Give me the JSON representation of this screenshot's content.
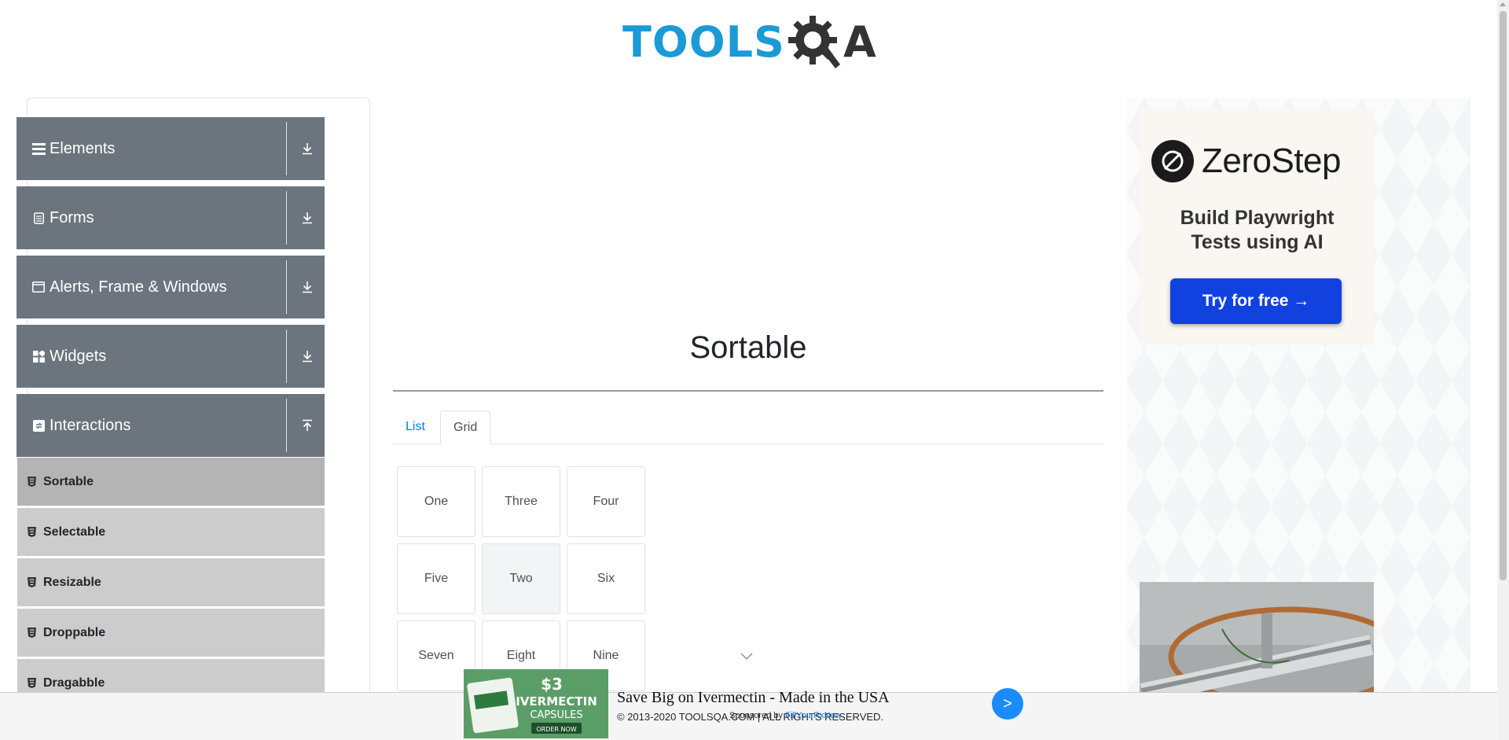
{
  "header": {
    "logo_text": "TOOLS",
    "logo_suffix": "A"
  },
  "sidebar": {
    "groups": [
      {
        "label": "Elements",
        "icon": "hamburger-icon",
        "state": "collapsed"
      },
      {
        "label": "Forms",
        "icon": "clipboard-icon",
        "state": "collapsed"
      },
      {
        "label": "Alerts, Frame & Windows",
        "icon": "window-icon",
        "state": "collapsed"
      },
      {
        "label": "Widgets",
        "icon": "widgets-icon",
        "state": "collapsed"
      },
      {
        "label": "Interactions",
        "icon": "interactions-icon",
        "state": "expanded"
      }
    ],
    "items": [
      {
        "label": "Sortable",
        "active": true
      },
      {
        "label": "Selectable"
      },
      {
        "label": "Resizable"
      },
      {
        "label": "Droppable"
      },
      {
        "label": "Dragabble"
      }
    ]
  },
  "main": {
    "title": "Sortable",
    "tabs": [
      {
        "label": "List"
      },
      {
        "label": "Grid",
        "active": true
      }
    ],
    "grid": [
      "One",
      "Three",
      "Four",
      "Five",
      "Two",
      "Six",
      "Seven",
      "Eight",
      "Nine"
    ]
  },
  "ad_right": {
    "brand": "ZeroStep",
    "headline_1": "Build Playwright",
    "headline_2": "Tests using AI",
    "cta": "Try for free →"
  },
  "footer": {
    "copyright": "© 2013-2020 TOOLSQA.COM | ALL RIGHTS RESERVED."
  },
  "ad_bottom": {
    "title": "Save Big on Ivermectin - Made in the USA",
    "sponsor_prefix": "Sponsored by",
    "sponsor_link": "FillYourRxNow",
    "next_label": ">",
    "product_price": "$3",
    "product_name_1": "IVERMECTIN",
    "product_name_2": "CAPSULES",
    "product_cta": "ORDER NOW"
  },
  "colors": {
    "sidebar_group": "#6c757d",
    "sidebar_item": "#cccccc",
    "link": "#007bff",
    "logo_blue": "#1a9ad6"
  }
}
